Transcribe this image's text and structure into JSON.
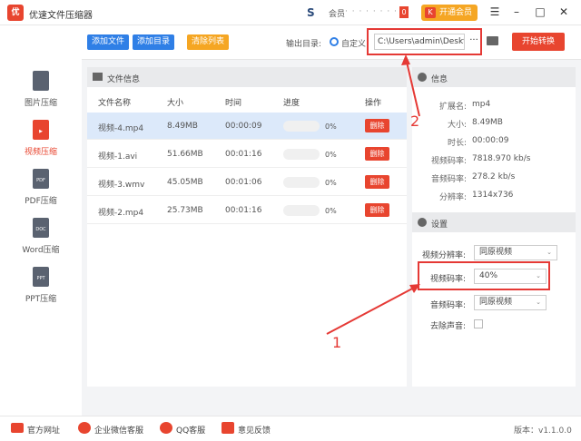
{
  "app": {
    "title": "优速文件压缩器",
    "logo_text": "优",
    "member_label": "会员",
    "member_masked": "· · · · · · · · ·",
    "badge": "0",
    "vip_label": "开通会员",
    "vip_icon": "K",
    "controls": [
      "menu-icon",
      "minimize-icon",
      "maximize-icon",
      "close-icon"
    ]
  },
  "sidebar": {
    "items": [
      {
        "label": "图片压缩",
        "icon": "image-file-icon",
        "active": false
      },
      {
        "label": "视频压缩",
        "icon": "video-file-icon",
        "active": true
      },
      {
        "label": "PDF压缩",
        "icon": "pdf-file-icon",
        "icon_text": "PDF",
        "active": false
      },
      {
        "label": "Word压缩",
        "icon": "doc-file-icon",
        "icon_text": "DOC",
        "active": false
      },
      {
        "label": "PPT压缩",
        "icon": "ppt-file-icon",
        "icon_text": "PPT",
        "active": false
      }
    ]
  },
  "toolbar": {
    "add_file": "添加文件",
    "add_dir": "添加目录",
    "clear_list": "清除列表",
    "output_dir_label": "输出目录:",
    "custom_label": "自定义",
    "output_path": "C:\\Users\\admin\\Deskto",
    "more": "···",
    "start": "开始转换",
    "colors": {
      "add": "#2f7fe6",
      "clear": "#f5a623",
      "start": "#e8452f"
    }
  },
  "file_panel": {
    "title": "文件信息",
    "columns": [
      "文件名称",
      "大小",
      "时间",
      "进度",
      "操作"
    ],
    "rows": [
      {
        "name": "视频-4.mp4",
        "size": "8.49MB",
        "time": "00:00:09",
        "progress": "0%",
        "action": "删除",
        "selected": true
      },
      {
        "name": "视频-1.avi",
        "size": "51.66MB",
        "time": "00:01:16",
        "progress": "0%",
        "action": "删除",
        "selected": false
      },
      {
        "name": "视频-3.wmv",
        "size": "45.05MB",
        "time": "00:01:06",
        "progress": "0%",
        "action": "删除",
        "selected": false
      },
      {
        "name": "视频-2.mp4",
        "size": "25.73MB",
        "time": "00:01:16",
        "progress": "0%",
        "action": "删除",
        "selected": false
      }
    ]
  },
  "info_panel": {
    "title": "信息",
    "items": [
      {
        "key": "扩展名:",
        "value": "mp4"
      },
      {
        "key": "大小:",
        "value": "8.49MB"
      },
      {
        "key": "时长:",
        "value": "00:00:09"
      },
      {
        "key": "视频码率:",
        "value": "7818.970 kb/s"
      },
      {
        "key": "音频码率:",
        "value": "278.2 kb/s"
      },
      {
        "key": "分辨率:",
        "value": "1314x736"
      }
    ]
  },
  "settings_panel": {
    "title": "设置",
    "resolution_label": "视频分辨率:",
    "resolution_value": "同原视频",
    "bitrate_label": "视频码率:",
    "bitrate_value": "40%",
    "audio_label": "音频码率:",
    "audio_value": "同原视频",
    "mute_label": "去除声音:",
    "mute_checked": false
  },
  "annotations": {
    "one": "1",
    "two": "2",
    "highlight_color": "#e53935"
  },
  "statusbar": {
    "site": "官方网址",
    "wechat": "企业微信客服",
    "qq": "QQ客服",
    "feedback": "意见反馈",
    "version": "版本：v1.1.0.0"
  }
}
